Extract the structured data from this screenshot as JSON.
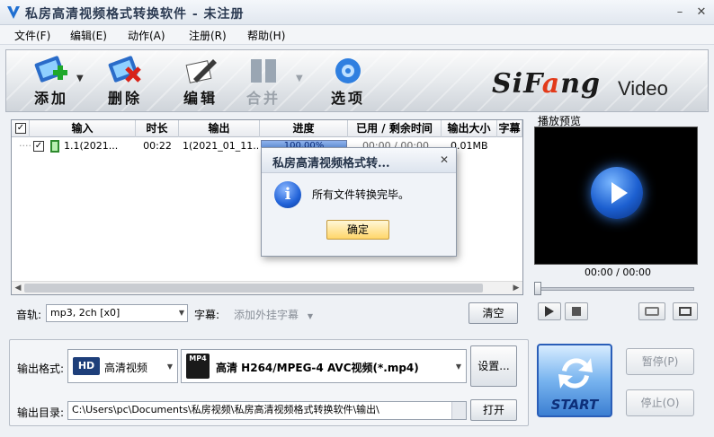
{
  "window": {
    "title": "私房高清视频格式转换软件 - 未注册",
    "minimize": "–",
    "close": "✕"
  },
  "menu": [
    "文件(F)",
    "编辑(E)",
    "动作(A)",
    "注册(R)",
    "帮助(H)"
  ],
  "toolbar": {
    "add": "添加",
    "delete": "删除",
    "edit": "编辑",
    "merge": "合并",
    "options": "选项",
    "brand_si": "Si",
    "brand_f": "F",
    "brand_a": "a",
    "brand_ng": "ng",
    "brand_video": "Video"
  },
  "table": {
    "columns": [
      "输入",
      "时长",
      "输出",
      "进度",
      "已用 / 剩余时间",
      "输出大小",
      "字幕"
    ],
    "rows": [
      {
        "input": "1.1(2021...",
        "duration": "00:22",
        "output": "1(2021_01_11...",
        "progress_text": "100.00%",
        "progress": 1.0,
        "time": "00:00 / 00:00",
        "size": "0.01MB"
      }
    ]
  },
  "preview": {
    "title": "播放预览",
    "time": "00:00 / 00:00",
    "seek_fraction": 0.0
  },
  "audio": {
    "label": "音轨:",
    "value": "mp3, 2ch [x0]"
  },
  "subtitle": {
    "label": "字幕:",
    "placeholder": "添加外挂字幕"
  },
  "clear_label": "清空",
  "output": {
    "format_label": "输出格式:",
    "category_icon": "HD",
    "category": "高清视频",
    "format_icon": "MP4",
    "format": "高清 H264/MPEG-4 AVC视频(*.mp4)",
    "settings_label": "设置...",
    "dir_label": "输出目录:",
    "dir_value": "C:\\Users\\pc\\Documents\\私房视频\\私房高清视频格式转换软件\\输出\\",
    "open_label": "打开"
  },
  "controls": {
    "start": "START",
    "pause": "暂停(P)",
    "stop": "停止(O)"
  },
  "dialog": {
    "title": "私房高清视频格式转...",
    "close": "✕",
    "icon": "i",
    "message": "所有文件转换完毕。",
    "ok": "确定"
  },
  "colors": {
    "accent": "#2162d8",
    "brand_red": "#e23a1a",
    "ok_button": "#ffd66a"
  }
}
